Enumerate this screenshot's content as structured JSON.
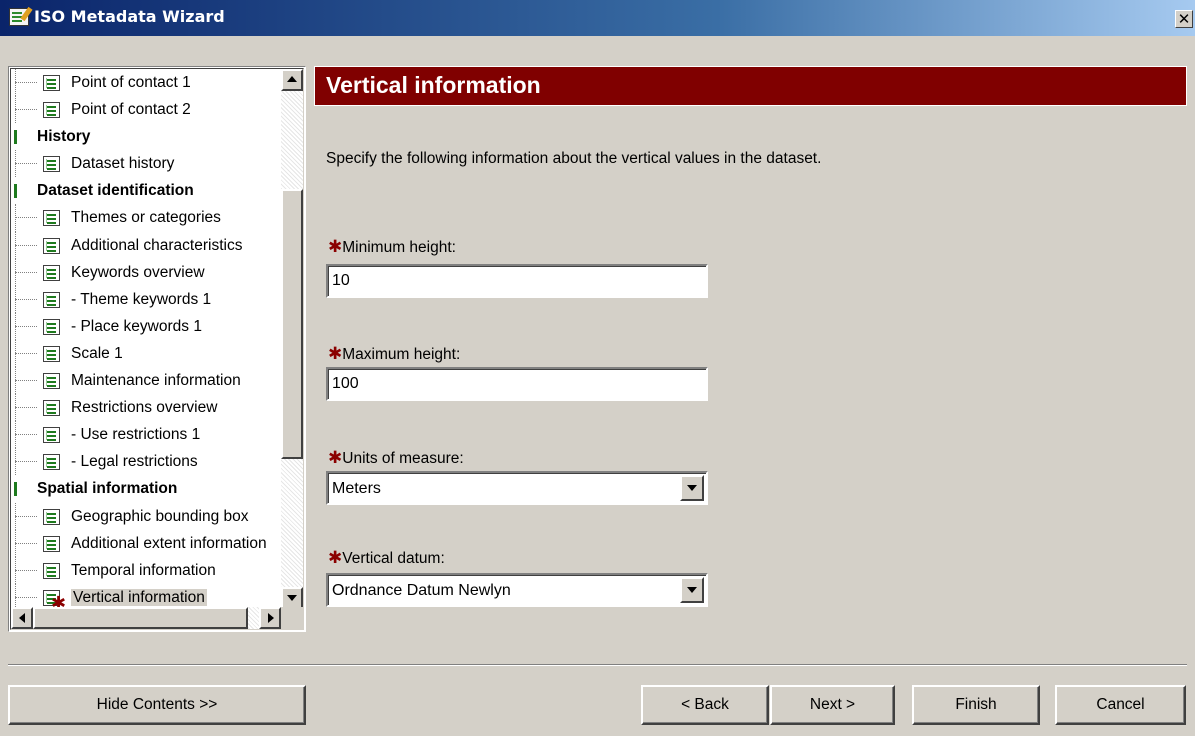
{
  "window": {
    "title": "ISO Metadata Wizard",
    "close_glyph": "✕"
  },
  "tree": {
    "items": [
      {
        "type": "leaf",
        "label": "Point of contact 1"
      },
      {
        "type": "leaf",
        "label": "Point of contact 2"
      },
      {
        "type": "group",
        "label": "History"
      },
      {
        "type": "leaf",
        "label": "Dataset history"
      },
      {
        "type": "group",
        "label": "Dataset identification"
      },
      {
        "type": "leaf",
        "label": "Themes or categories"
      },
      {
        "type": "leaf",
        "label": "Additional characteristics"
      },
      {
        "type": "leaf",
        "label": "Keywords overview"
      },
      {
        "type": "leaf",
        "label": "- Theme keywords 1"
      },
      {
        "type": "leaf",
        "label": "- Place keywords 1"
      },
      {
        "type": "leaf",
        "label": "Scale 1"
      },
      {
        "type": "leaf",
        "label": "Maintenance information"
      },
      {
        "type": "leaf",
        "label": "Restrictions overview"
      },
      {
        "type": "leaf",
        "label": "- Use restrictions 1"
      },
      {
        "type": "leaf",
        "label": "- Legal restrictions"
      },
      {
        "type": "group",
        "label": "Spatial information"
      },
      {
        "type": "leaf",
        "label": "Geographic bounding box"
      },
      {
        "type": "leaf",
        "label": "Additional extent information"
      },
      {
        "type": "leaf",
        "label": "Temporal information"
      },
      {
        "type": "leaf",
        "label": "Vertical information",
        "current": true,
        "required_mark": "✱"
      }
    ]
  },
  "page": {
    "title": "Vertical information",
    "intro": "Specify the following information about the vertical values in the dataset.",
    "required_star": "✱",
    "fields": {
      "min_height": {
        "label": "Minimum height:",
        "value": "10"
      },
      "max_height": {
        "label": "Maximum height:",
        "value": "100"
      },
      "units": {
        "label": "Units of measure:",
        "value": "Meters"
      },
      "datum": {
        "label": "Vertical datum:",
        "value": "Ordnance Datum Newlyn"
      }
    }
  },
  "buttons": {
    "hide_contents": "Hide Contents >>",
    "back": "< Back",
    "next": "Next >",
    "finish": "Finish",
    "cancel": "Cancel"
  },
  "colors": {
    "header_bg": "#800000",
    "required_star": "#8b0000",
    "title_bar": "#0a246a"
  }
}
